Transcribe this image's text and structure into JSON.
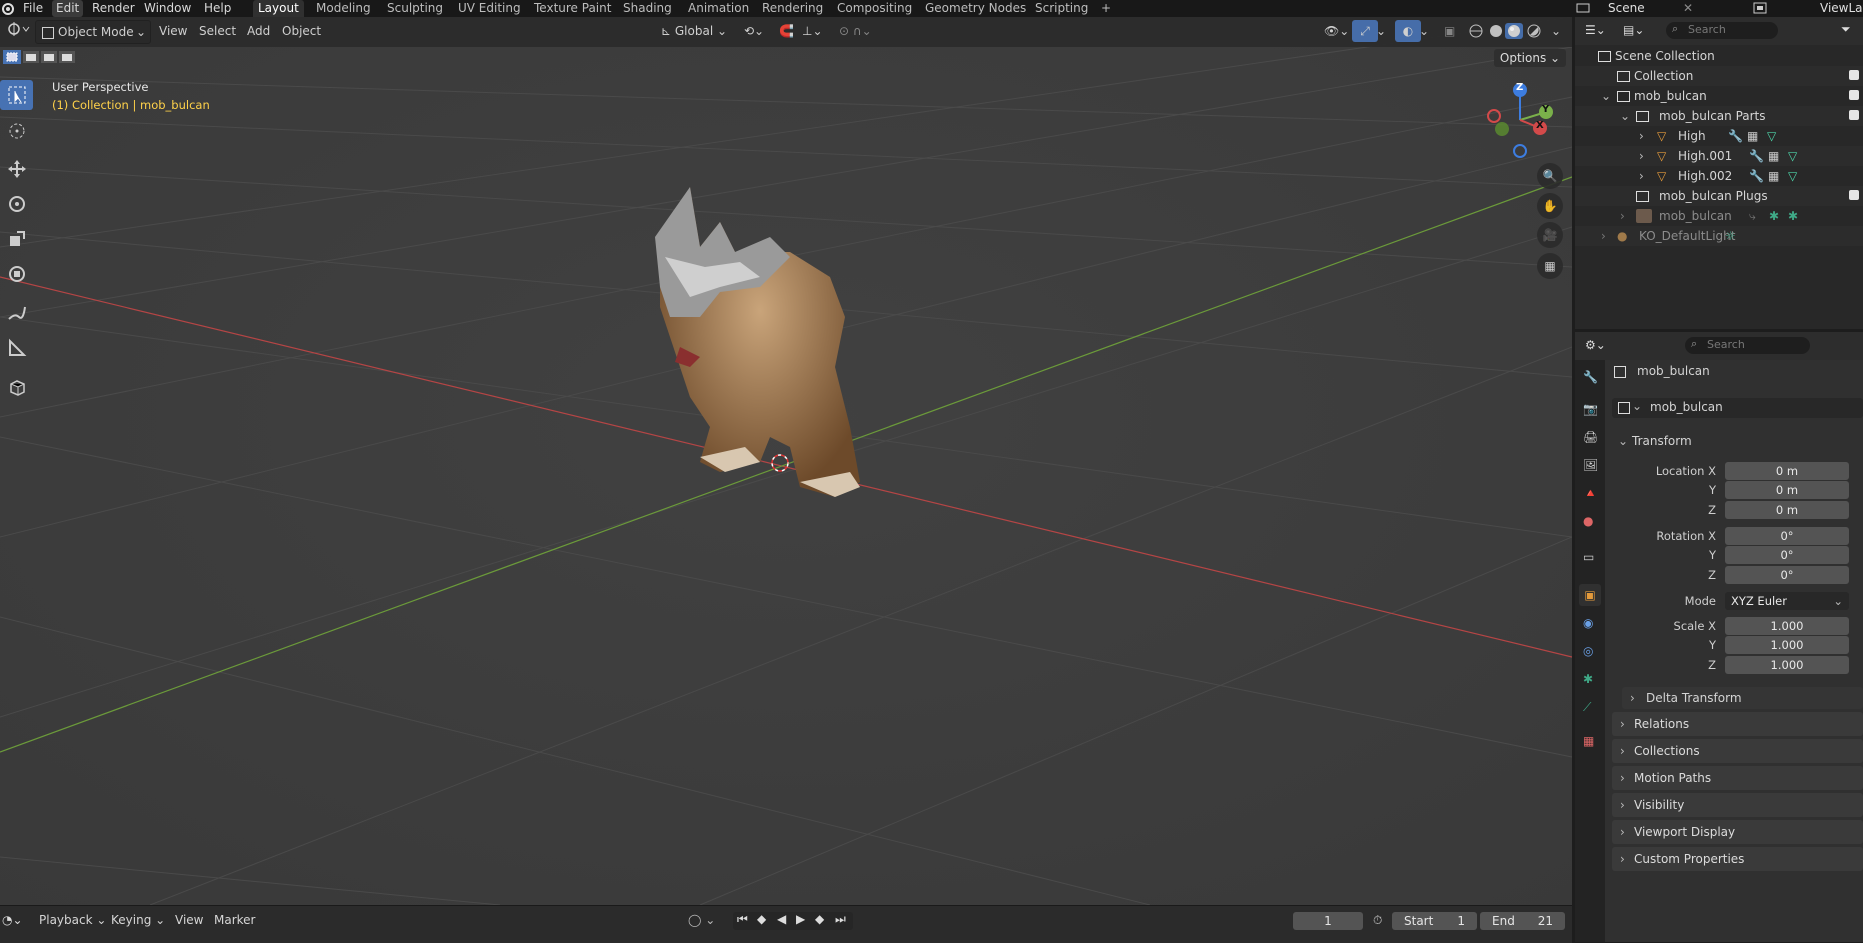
{
  "topbar": {
    "menus": [
      "File",
      "Edit",
      "Render",
      "Window",
      "Help"
    ],
    "workspaces": [
      "Layout",
      "Modeling",
      "Sculpting",
      "UV Editing",
      "Texture Paint",
      "Shading",
      "Animation",
      "Rendering",
      "Compositing",
      "Geometry Nodes",
      "Scripting"
    ],
    "add_tab": "+",
    "scene_label": "Scene",
    "viewlayer_label": "ViewLayer"
  },
  "viewport_header": {
    "mode": "Object Mode",
    "menus": [
      "View",
      "Select",
      "Add",
      "Object"
    ],
    "orientation": "Global",
    "options": "Options"
  },
  "viewport": {
    "perspective_label": "User Perspective",
    "collection_label": "(1) Collection | mob_bulcan",
    "gizmo_axes": [
      "Z",
      "Y",
      "X"
    ]
  },
  "outliner": {
    "search_placeholder": "Search",
    "rows": [
      {
        "label": "Scene Collection"
      },
      {
        "label": "Collection"
      },
      {
        "label": "mob_bulcan"
      },
      {
        "label": "mob_bulcan Parts"
      },
      {
        "label": "High"
      },
      {
        "label": "High.001"
      },
      {
        "label": "High.002"
      },
      {
        "label": "mob_bulcan Plugs"
      },
      {
        "label": "mob_bulcan"
      },
      {
        "label": "KO_DefaultLight"
      }
    ]
  },
  "properties": {
    "search_placeholder": "Search",
    "object_name": "mob_bulcan",
    "datablock_name": "mob_bulcan",
    "transform": {
      "title": "Transform",
      "location_label": "Location X",
      "rotation_label": "Rotation X",
      "scale_label": "Scale X",
      "y_label": "Y",
      "z_label": "Z",
      "location": [
        "0 m",
        "0 m",
        "0 m"
      ],
      "rotation": [
        "0°",
        "0°",
        "0°"
      ],
      "mode_label": "Mode",
      "mode_value": "XYZ Euler",
      "scale": [
        "1.000",
        "1.000",
        "1.000"
      ],
      "delta": "Delta Transform"
    },
    "panels": [
      "Relations",
      "Collections",
      "Motion Paths",
      "Visibility",
      "Viewport Display",
      "Custom Properties"
    ]
  },
  "timeline": {
    "menus": [
      "Playback",
      "Keying",
      "View",
      "Marker"
    ],
    "current_frame": "1",
    "start_label": "Start",
    "start_value": "1",
    "end_label": "End",
    "end_value": "21"
  },
  "colors": {
    "accent": "#4772b3",
    "x_axis": "#d34a4a",
    "y_axis": "#7ab04a",
    "z_axis": "#3d7de0",
    "selection_text": "#ffd24a"
  }
}
